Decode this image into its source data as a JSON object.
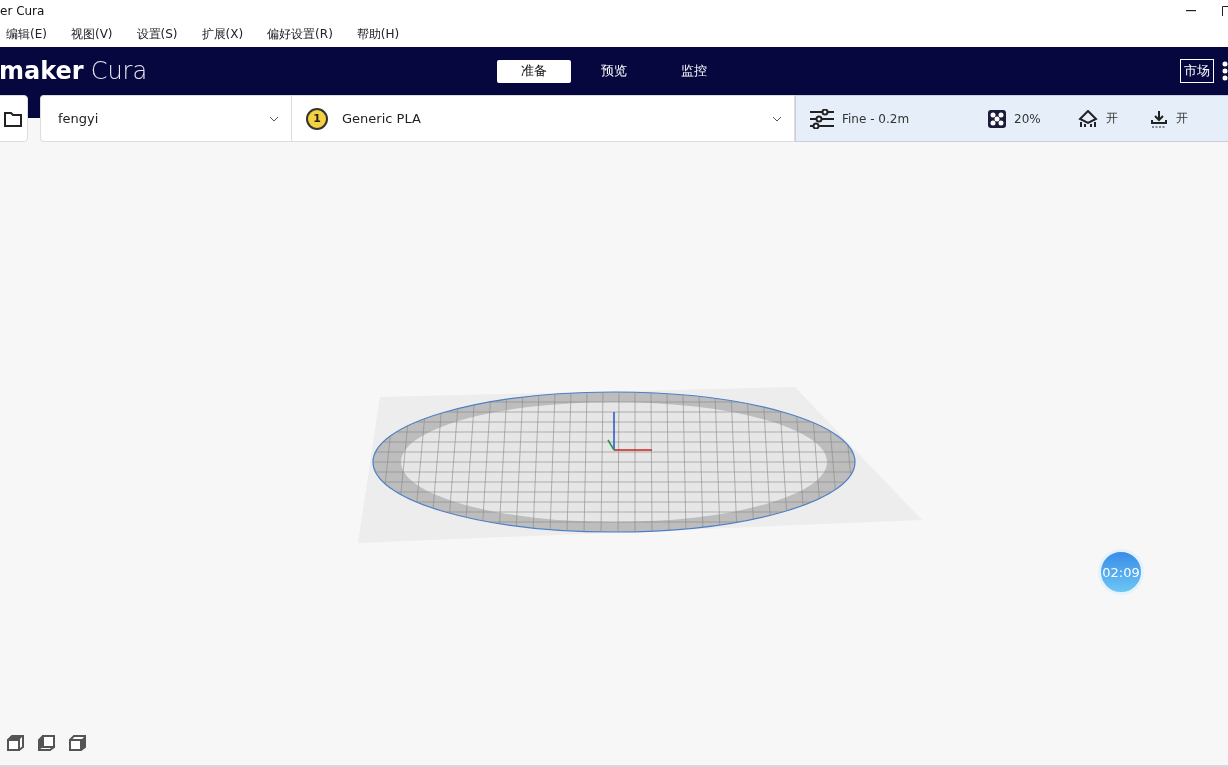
{
  "window": {
    "title": "er Cura"
  },
  "menu": [
    "编辑(E)",
    "视图(V)",
    "设置(S)",
    "扩展(X)",
    "偏好设置(R)",
    "帮助(H)"
  ],
  "header": {
    "logo_bold": "maker",
    "logo_light": "Cura",
    "marketplace": "市场",
    "tabs": [
      {
        "label": "准备",
        "selected": true
      },
      {
        "label": "预览",
        "selected": false
      },
      {
        "label": "监控",
        "selected": false
      }
    ]
  },
  "toolbar": {
    "printer": "fengyi",
    "material_badge": "1",
    "material": "Generic PLA",
    "profile": "Fine - 0.2m",
    "infill": "20%",
    "support": "开",
    "adhesion": "开"
  },
  "timer": "02:09"
}
